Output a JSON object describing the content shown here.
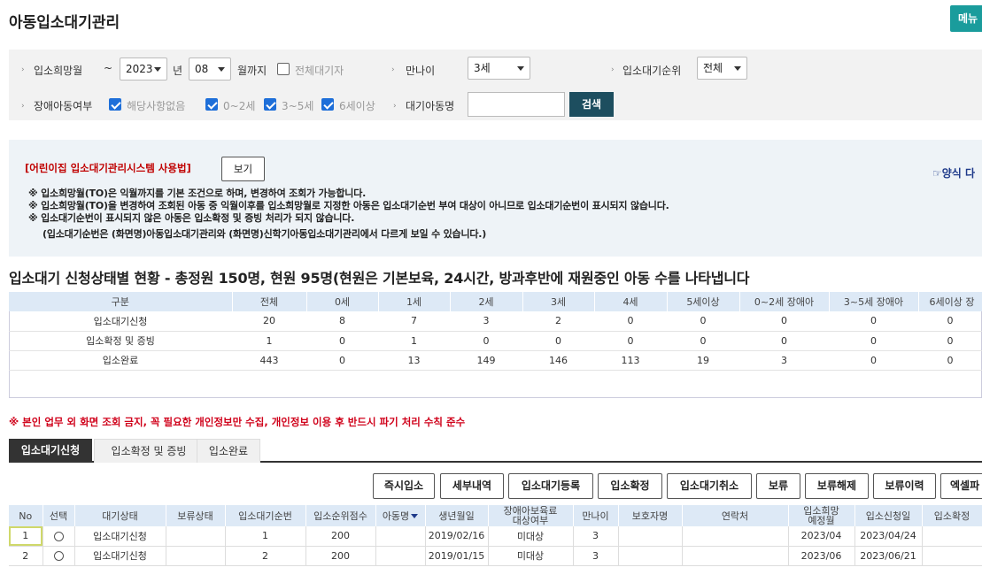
{
  "page_title": "아동입소대기관리",
  "menu_label": "메뉴",
  "search": {
    "hope_month_label": "입소희망월",
    "tilde": "~",
    "year_value": "2023",
    "year_suffix": "년",
    "month_value": "08",
    "month_suffix": "월까지",
    "all_wait_label": "전체대기자",
    "age_label": "만나이",
    "age_value": "3세",
    "order_label": "입소대기순위",
    "order_value": "전체",
    "disabled_label": "장애아동여부",
    "cb_none_label": "해당사항없음",
    "cb_0_2_label": "0~2세",
    "cb_3_5_label": "3~5세",
    "cb_6_label": "6세이상",
    "child_name_label": "대기아동명",
    "child_name_value": "",
    "search_button": "검색"
  },
  "notice": {
    "red_text": "[어린이집 입소대기관리시스템 사용법]",
    "view_button": "보기",
    "form_link": "☞양식 다",
    "lines": [
      "※ 입소희망월(TO)은 익월까지를 기본 조건으로 하며, 변경하여 조회가 가능합니다.",
      "※ 입소희망월(TO)을 변경하여 조회된 아동 중 익월이후를 입소희망월로 지정한 아동은 입소대기순번 부여 대상이 아니므로 입소대기순번이 표시되지 않습니다.",
      "※ 입소대기순번이 표시되지 않은 아동은 입소확정 및 증빙 처리가 되지 않습니다.",
      "(입소대기순번은 (화면명)아동입소대기관리와 (화면명)신학기아동입소대기관리에서 다르게 보일 수 있습니다.)"
    ]
  },
  "status_title": "입소대기 신청상태별 현황 - 총정원 150명, 현원 95명(현원은 기본보육, 24시간, 방과후반에 재원중인 아동 수를 나타냅니다",
  "status_table": {
    "headers": [
      "구분",
      "전체",
      "0세",
      "1세",
      "2세",
      "3세",
      "4세",
      "5세이상",
      "0~2세 장애아",
      "3~5세 장애아",
      "6세이상 장"
    ],
    "rows": [
      [
        "입소대기신청",
        "20",
        "8",
        "7",
        "3",
        "2",
        "0",
        "0",
        "0",
        "0",
        "0"
      ],
      [
        "입소확정 및 증빙",
        "1",
        "0",
        "1",
        "0",
        "0",
        "0",
        "0",
        "0",
        "0",
        "0"
      ],
      [
        "입소완료",
        "443",
        "0",
        "13",
        "149",
        "146",
        "113",
        "19",
        "3",
        "0",
        "0"
      ]
    ]
  },
  "warning": "※ 본인 업무 외 화면 조회 금지, 꼭 필요한 개인정보만 수집, 개인정보 이용 후 반드시 파기 처리 수칙 준수",
  "tabs": [
    "입소대기신청",
    "입소확정 및 증빙",
    "입소완료"
  ],
  "actions": [
    "즉시입소",
    "세부내역",
    "입소대기등록",
    "입소확정",
    "입소대기취소",
    "보류",
    "보류해제",
    "보류이력",
    "엑셀파"
  ],
  "list_table": {
    "headers": [
      "No",
      "선택",
      "대기상태",
      "보류상태",
      "입소대기순번",
      "입소순위점수",
      "아동명",
      "생년월일",
      "장애아보육료\n대상여부",
      "만나이",
      "보호자명",
      "연락처",
      "입소희망\n예정월",
      "입소신청일",
      "입소확정"
    ],
    "rows": [
      [
        "1",
        "",
        "입소대기신청",
        "",
        "1",
        "200",
        "",
        "2019/02/16",
        "미대상",
        "3",
        "",
        "",
        "2023/04",
        "2023/04/24",
        ""
      ],
      [
        "2",
        "",
        "입소대기신청",
        "",
        "2",
        "200",
        "",
        "2019/01/15",
        "미대상",
        "3",
        "",
        "",
        "2023/06",
        "2023/06/21",
        ""
      ]
    ]
  },
  "colors": {
    "accent": "#1a9c9c",
    "search_btn": "#1d4e5f",
    "header_bg": "#dde9f6",
    "warn": "#d0021b"
  }
}
